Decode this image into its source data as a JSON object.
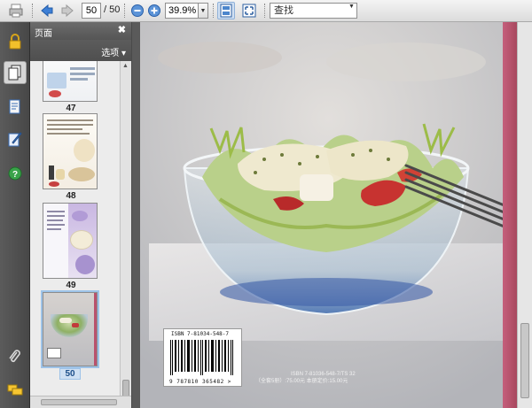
{
  "toolbar": {
    "page_current": "50",
    "page_total": "/ 50",
    "zoom": "39.9%",
    "search_placeholder": "查找"
  },
  "panel": {
    "title": "页面",
    "close": "✖",
    "options": "选项 ▾"
  },
  "thumbnails": [
    {
      "label": "47"
    },
    {
      "label": "48"
    },
    {
      "label": "49"
    },
    {
      "label": "50"
    }
  ],
  "cover": {
    "isbn_top": "ISBN 7-81034-548-7",
    "isbn_bottom": "9 787810 365482 >",
    "cip_line1": "ISBN 7-81036-548-7/TS 32",
    "cip_line2": "（全套5册）:75.00元  本册定价:15.00元"
  },
  "colors": {
    "accent_spine": "#b9526d",
    "help_icon": "#3aa34a",
    "nav_arrow": "#3d7fd6"
  }
}
